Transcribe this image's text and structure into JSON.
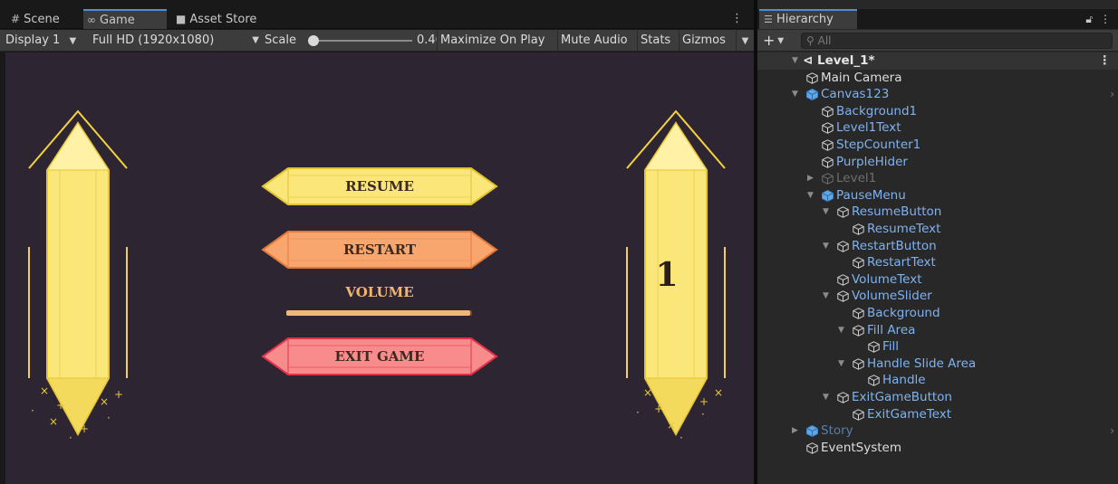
{
  "game": {
    "tabs": [
      {
        "icon": "#",
        "label": "Scene"
      },
      {
        "icon": "∞",
        "label": "Game"
      },
      {
        "icon": "■",
        "label": "Asset Store"
      }
    ],
    "toolbar": {
      "display": "Display 1",
      "resolution": "Full HD (1920x1080)",
      "scale_label": "Scale",
      "scale_value": "0.462",
      "maximize": "Maximize On Play",
      "mute": "Mute Audio",
      "stats": "Stats",
      "gizmos": "Gizmos"
    },
    "view": {
      "buttons": {
        "resume": "RESUME",
        "restart": "RESTART",
        "exit": "EXIT GAME"
      },
      "volume_label": "VOLUME",
      "volume_fraction": 0.99,
      "level_number": "1"
    },
    "colors": {
      "background": "#2e2533",
      "resume": "#fbe67a",
      "restart": "#f9a66e",
      "exit": "#f88c8c",
      "crystal": "#fbe67a"
    }
  },
  "hierarchy": {
    "tab_label": "Hierarchy",
    "add_label": "+",
    "search_placeholder": "All",
    "scene_name": "Level_1*",
    "rows": [
      {
        "label": "Main Camera",
        "depth": 1,
        "color": "white",
        "expander": "none",
        "icon": "obj"
      },
      {
        "label": "Canvas123",
        "depth": 1,
        "color": "blue",
        "expander": "open",
        "icon": "prefab",
        "arrow": true
      },
      {
        "label": "Background1",
        "depth": 2,
        "color": "blue",
        "expander": "none",
        "icon": "obj"
      },
      {
        "label": "Level1Text",
        "depth": 2,
        "color": "blue",
        "expander": "none",
        "icon": "obj"
      },
      {
        "label": "StepCounter1",
        "depth": 2,
        "color": "blue",
        "expander": "none",
        "icon": "obj"
      },
      {
        "label": "PurpleHider",
        "depth": 2,
        "color": "blue",
        "expander": "none",
        "icon": "obj"
      },
      {
        "label": "Level1",
        "depth": 2,
        "color": "dim",
        "expander": "closed",
        "icon": "obj"
      },
      {
        "label": "PauseMenu",
        "depth": 2,
        "color": "blue",
        "expander": "open",
        "icon": "prefab"
      },
      {
        "label": "ResumeButton",
        "depth": 3,
        "color": "blue",
        "expander": "open",
        "icon": "obj"
      },
      {
        "label": "ResumeText",
        "depth": 4,
        "color": "blue",
        "expander": "none",
        "icon": "obj"
      },
      {
        "label": "RestartButton",
        "depth": 3,
        "color": "blue",
        "expander": "open",
        "icon": "obj"
      },
      {
        "label": "RestartText",
        "depth": 4,
        "color": "blue",
        "expander": "none",
        "icon": "obj"
      },
      {
        "label": "VolumeText",
        "depth": 3,
        "color": "blue",
        "expander": "none",
        "icon": "obj"
      },
      {
        "label": "VolumeSlider",
        "depth": 3,
        "color": "blue",
        "expander": "open",
        "icon": "obj"
      },
      {
        "label": "Background",
        "depth": 4,
        "color": "blue",
        "expander": "none",
        "icon": "obj"
      },
      {
        "label": "Fill Area",
        "depth": 4,
        "color": "blue",
        "expander": "open",
        "icon": "obj"
      },
      {
        "label": "Fill",
        "depth": 5,
        "color": "blue",
        "expander": "none",
        "icon": "obj"
      },
      {
        "label": "Handle Slide Area",
        "depth": 4,
        "color": "blue",
        "expander": "open",
        "icon": "obj"
      },
      {
        "label": "Handle",
        "depth": 5,
        "color": "blue",
        "expander": "none",
        "icon": "obj"
      },
      {
        "label": "ExitGameButton",
        "depth": 3,
        "color": "blue",
        "expander": "open",
        "icon": "obj"
      },
      {
        "label": "ExitGameText",
        "depth": 4,
        "color": "blue",
        "expander": "none",
        "icon": "obj"
      },
      {
        "label": "Story",
        "depth": 1,
        "color": "dimblue",
        "expander": "closed",
        "icon": "prefab",
        "arrow": true
      },
      {
        "label": "EventSystem",
        "depth": 1,
        "color": "white",
        "expander": "none",
        "icon": "obj"
      }
    ]
  }
}
